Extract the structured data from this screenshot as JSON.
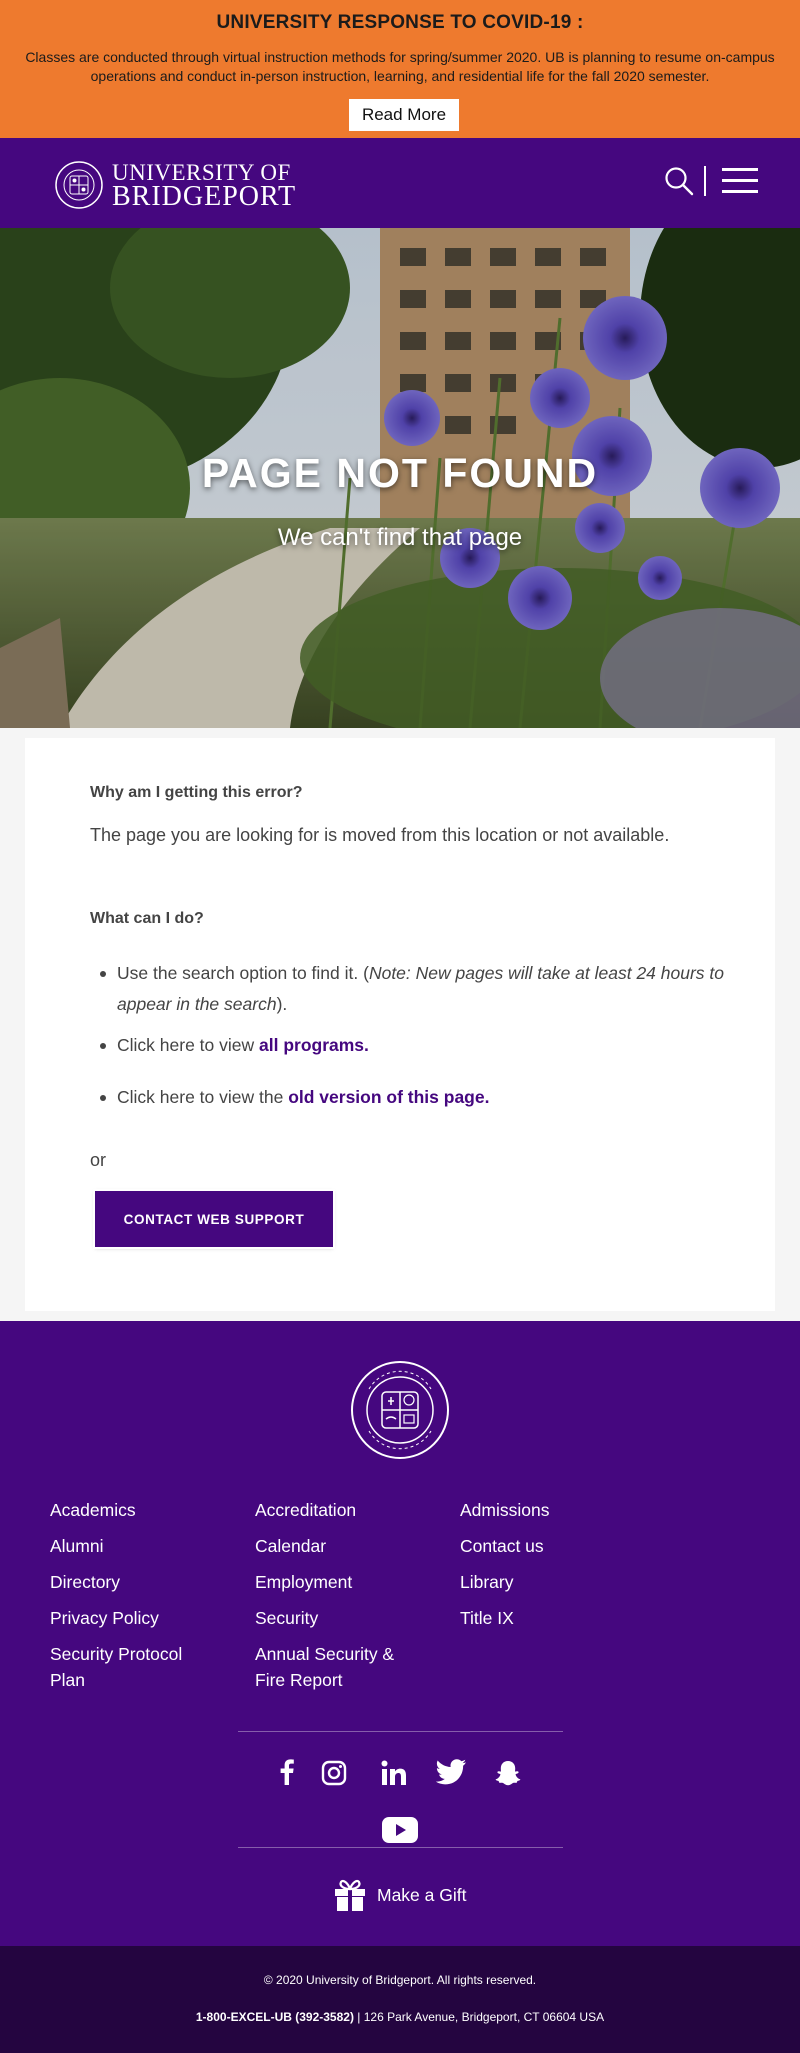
{
  "covid_banner": {
    "title": "UNIVERSITY RESPONSE TO COVID-19 :",
    "text": "Classes are conducted through virtual instruction methods for spring/summer 2020. UB is planning to resume on-campus operations and conduct in-person instruction, learning, and residential life for the fall 2020 semester.",
    "button": "Read More",
    "bg_color": "#ee7a2e"
  },
  "header": {
    "logo_line1": "UNIVERSITY OF",
    "logo_line2": "BRIDGEPORT",
    "brand_color": "#45077f",
    "icons": [
      "search-icon",
      "menu-icon"
    ]
  },
  "hero": {
    "title": "PAGE NOT FOUND",
    "subtitle": "We can't find that page"
  },
  "content": {
    "q1": "Why am I getting this error?",
    "a1": "The page you are looking for is moved from this location or not available.",
    "q2": "What can I do?",
    "item1_text": "Use the search option to find it. (",
    "item1_note": "Note: New pages will take at least 24 hours to appear in the search",
    "item1_end": ").",
    "item2_text": "Click here to view ",
    "item2_link": "all programs.",
    "item3_text": "Click here to view the ",
    "item3_link": "old version of this page.",
    "or": "or",
    "contact_button": "CONTACT WEB SUPPORT"
  },
  "footer": {
    "col1": [
      "Academics",
      "Alumni",
      "Directory",
      "Privacy Policy",
      "Security Protocol Plan"
    ],
    "col2": [
      "Accreditation",
      "Calendar",
      "Employment",
      "Security",
      "Annual Security & Fire Report"
    ],
    "col3": [
      "Admissions",
      "Contact us",
      "Library",
      "Title IX"
    ],
    "social_icons": [
      "facebook-icon",
      "instagram-icon",
      "linkedin-icon",
      "twitter-icon",
      "snapchat-icon",
      "youtube-icon"
    ],
    "gift_label": "Make a Gift",
    "copyright": "© 2020 University of Bridgeport. All rights reserved.",
    "phone": "1-800-EXCEL-UB (392-3582)",
    "address": " | 126 Park Avenue, Bridgeport, CT 06604 USA"
  }
}
